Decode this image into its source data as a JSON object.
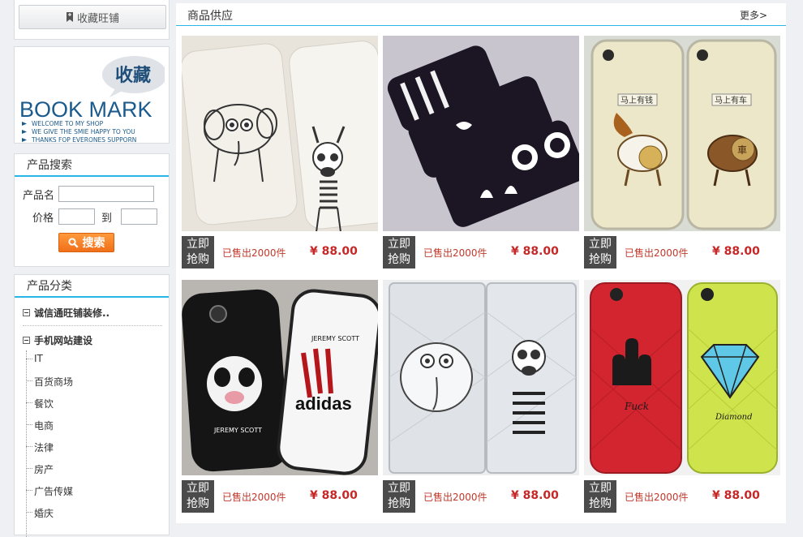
{
  "sidebar": {
    "favorite_label": "收藏旺铺",
    "bookmark": {
      "title": "BOOK MARK",
      "bubble": "收藏",
      "lines": [
        "WELCOME TO MY SHOP",
        "WE GIVE THE SMIE HAPPY TO YOU",
        "THANKS FOP EVERONES SUPPORN"
      ]
    },
    "search": {
      "title": "产品搜索",
      "name_label": "产品名",
      "price_label": "价格",
      "to_label": "到",
      "button_label": "搜索"
    },
    "categories": {
      "title": "产品分类",
      "group1": "诚信通旺铺装修..",
      "group2": "手机网站建设",
      "items": [
        "IT",
        "百货商场",
        "餐饮",
        "电商",
        "法律",
        "房产",
        "广告传媒",
        "婚庆"
      ]
    }
  },
  "main": {
    "title": "商品供应",
    "more_label": "更多>",
    "products": [
      {
        "buy": "立即抢购",
        "sold": "已售出2000件",
        "price": "¥ 88.00"
      },
      {
        "buy": "立即抢购",
        "sold": "已售出2000件",
        "price": "¥ 88.00"
      },
      {
        "buy": "立即抢购",
        "sold": "已售出2000件",
        "price": "¥ 88.00"
      },
      {
        "buy": "立即抢购",
        "sold": "已售出2000件",
        "price": "¥ 88.00"
      },
      {
        "buy": "立即抢购",
        "sold": "已售出2000件",
        "price": "¥ 88.00"
      },
      {
        "buy": "立即抢购",
        "sold": "已售出2000件",
        "price": "¥ 88.00"
      }
    ],
    "product_images": [
      {
        "art_text": []
      },
      {
        "art_text": []
      },
      {
        "art_text": [
          "马上有钱",
          "马上有车",
          "車"
        ]
      },
      {
        "art_text": [
          "JEREMY SCOTT",
          "adidas",
          "JEREMY SCOTT"
        ]
      },
      {
        "art_text": []
      },
      {
        "art_text": [
          "Fuck",
          "Diamond"
        ]
      }
    ]
  },
  "colors": {
    "accent": "#29b6e6",
    "price": "#c62828",
    "buy_button": "#4b4b4b",
    "search_button": "#f07a1e"
  }
}
